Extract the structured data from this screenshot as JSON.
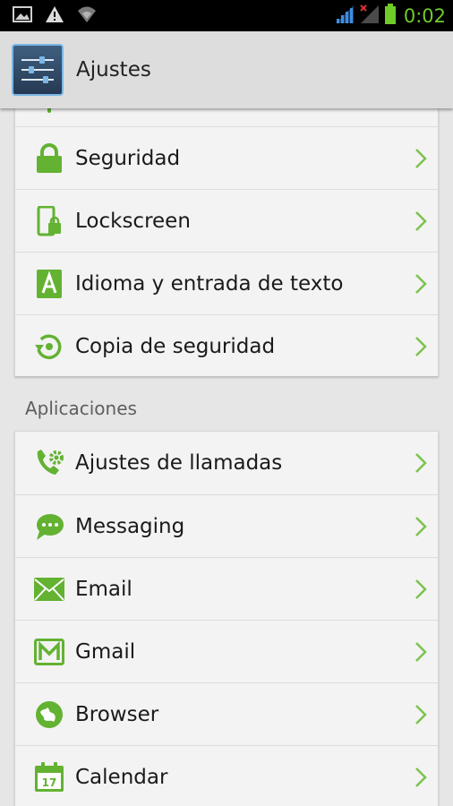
{
  "status_bar": {
    "time": "0:02",
    "time_color": "#6ecb2a"
  },
  "action_bar": {
    "title": "Ajustes",
    "icon": "settings-sliders-icon"
  },
  "sections": {
    "personal": {
      "items": [
        {
          "label": "Seguridad",
          "icon": "lock-icon"
        },
        {
          "label": "Lockscreen",
          "icon": "phone-lock-icon"
        },
        {
          "label": "Idioma y entrada de texto",
          "icon": "language-a-icon"
        },
        {
          "label": "Copia de seguridad",
          "icon": "backup-icon"
        }
      ]
    },
    "apps": {
      "header": "Aplicaciones",
      "items": [
        {
          "label": "Ajustes de llamadas",
          "icon": "call-settings-icon"
        },
        {
          "label": "Messaging",
          "icon": "messaging-icon"
        },
        {
          "label": "Email",
          "icon": "email-icon"
        },
        {
          "label": "Gmail",
          "icon": "gmail-icon"
        },
        {
          "label": "Browser",
          "icon": "browser-icon"
        },
        {
          "label": "Calendar",
          "icon": "calendar-icon",
          "badge": "17"
        }
      ]
    }
  },
  "colors": {
    "accent_green": "#63b232",
    "chevron": "#7cc34c"
  }
}
